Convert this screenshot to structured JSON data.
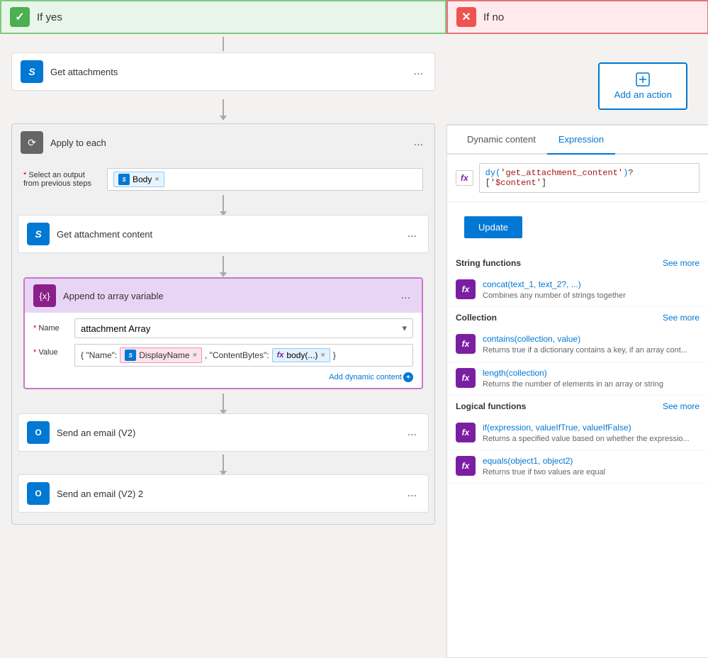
{
  "if_yes": {
    "label": "If yes",
    "check_symbol": "✓"
  },
  "if_no": {
    "label": "If no",
    "x_symbol": "✕"
  },
  "cards": {
    "get_attachments": {
      "title": "Get attachments",
      "more": "..."
    },
    "apply_to_each": {
      "title": "Apply to each",
      "more": "...",
      "select_label": "* Select an output\nfrom previous steps",
      "tag_label": "Body",
      "tag_x": "×"
    },
    "get_attachment_content": {
      "title": "Get attachment content",
      "more": "..."
    },
    "append_to_array": {
      "title": "Append to array variable",
      "more": "...",
      "name_label": "* Name",
      "name_value": "attachment Array",
      "value_label": "* Value",
      "value_prefix": "{ \"Name\":",
      "display_name_tag": "DisplayName",
      "value_middle": ", \"ContentBytes\":",
      "body_tag": "body(...)",
      "value_suffix": " }",
      "add_dynamic": "Add dynamic content",
      "add_dynamic_plus": "+"
    },
    "send_email_1": {
      "title": "Send an email (V2)",
      "more": "..."
    },
    "send_email_2": {
      "title": "Send an email (V2) 2",
      "more": "..."
    }
  },
  "add_action": {
    "label": "Add an action",
    "icon": "⊞"
  },
  "dynamic_panel": {
    "tab_dynamic": "Dynamic content",
    "tab_expression": "Expression",
    "fx_label": "fx",
    "expression_value": "dy('get_attachment_content')?['$content'",
    "update_btn": "Update",
    "sections": [
      {
        "key": "string_functions",
        "label": "String functions",
        "see_more": "See more",
        "functions": [
          {
            "name": "concat(text_1, text_2?, ...)",
            "desc": "Combines any number of strings together"
          }
        ]
      },
      {
        "key": "collection",
        "label": "Collection",
        "see_more": "See more",
        "functions": [
          {
            "name": "contains(collection, value)",
            "desc": "Returns true if a dictionary contains a key, if an array cont..."
          },
          {
            "name": "length(collection)",
            "desc": "Returns the number of elements in an array or string"
          }
        ]
      },
      {
        "key": "logical_functions",
        "label": "Logical functions",
        "see_more": "See more",
        "functions": [
          {
            "name": "if(expression, valueIfTrue, valueIfFalse)",
            "desc": "Returns a specified value based on whether the expressio..."
          },
          {
            "name": "equals(object1, object2)",
            "desc": "Returns true if two values are equal"
          }
        ]
      }
    ]
  }
}
